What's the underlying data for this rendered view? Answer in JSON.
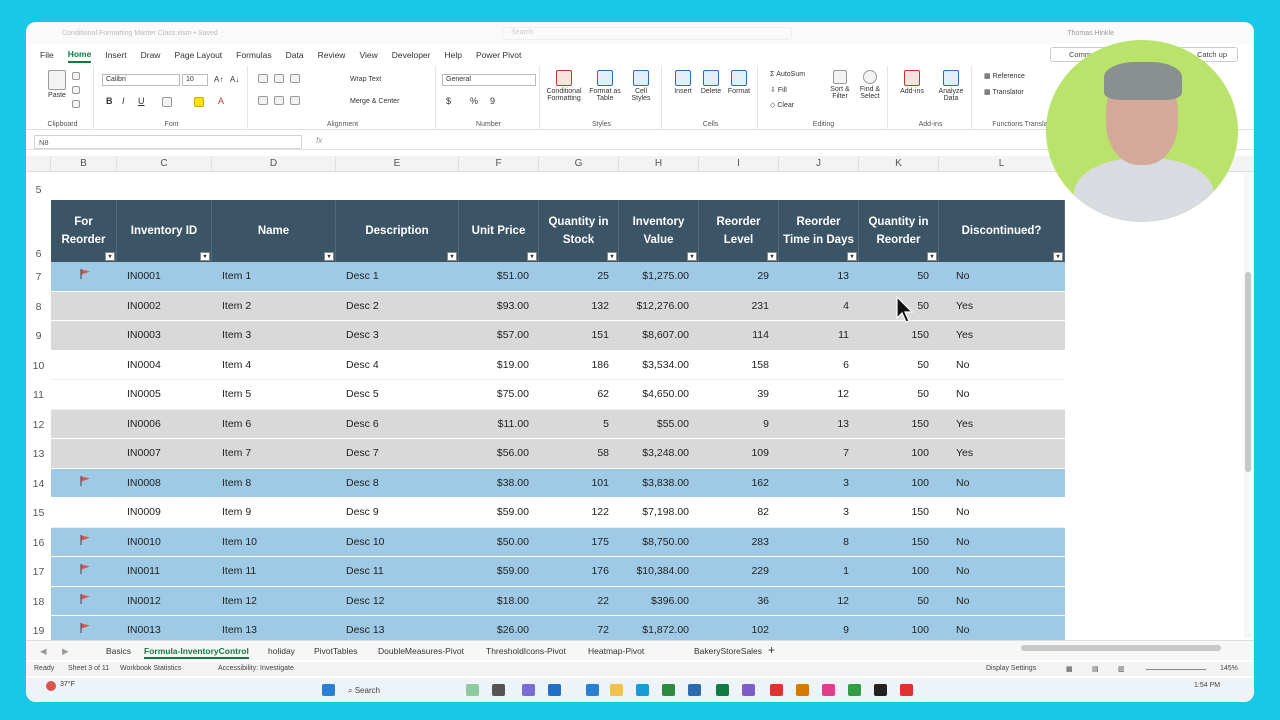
{
  "window": {
    "doc_title": "Conditional Formatting Master Class.xlsm • Saved",
    "search_placeholder": "Search",
    "user_name": "Thomas Hinkle",
    "comments_label": "Comm",
    "catch_up_label": "Catch up"
  },
  "menu_tabs": [
    "File",
    "Home",
    "Insert",
    "Draw",
    "Page Layout",
    "Formulas",
    "Data",
    "Review",
    "View",
    "Developer",
    "Help",
    "Power Pivot"
  ],
  "active_tab": "Home",
  "ribbon": {
    "clipboard": {
      "paste": "Paste",
      "label": "Clipboard"
    },
    "font": {
      "name": "Calibri",
      "size": "10",
      "label": "Font",
      "bold": "B",
      "italic": "I",
      "underline": "U"
    },
    "alignment": {
      "wrap": "Wrap Text",
      "merge": "Merge & Center",
      "label": "Alignment"
    },
    "number": {
      "format": "General",
      "currency": "$",
      "percent": "%",
      "comma": "9",
      "label": "Number"
    },
    "styles": {
      "conditional": "Conditional Formatting",
      "table": "Format as Table",
      "cell": "Cell Styles",
      "label": "Styles"
    },
    "cells": {
      "insert": "Insert",
      "delete": "Delete",
      "format": "Format",
      "label": "Cells"
    },
    "editing": {
      "autosum": "AutoSum",
      "fill": "Fill",
      "clear": "Clear",
      "sort": "Sort & Filter",
      "find": "Find & Select",
      "label": "Editing"
    },
    "addins": {
      "addins": "Add-ins",
      "analyze": "Analyze Data",
      "label": "Add-ins"
    },
    "functions": {
      "reference": "Reference",
      "translator": "Translator",
      "label": "Functions Translator"
    }
  },
  "formula_bar": {
    "name_box": "N8",
    "fx": "fx",
    "value": ""
  },
  "column_letters": [
    "B",
    "C",
    "D",
    "E",
    "F",
    "G",
    "H",
    "I",
    "J",
    "K",
    "L"
  ],
  "table": {
    "headers": [
      "For Reorder",
      "Inventory ID",
      "Name",
      "Description",
      "Unit Price",
      "Quantity in Stock",
      "Inventory Value",
      "Reorder Level",
      "Reorder Time in Days",
      "Quantity in Reorder",
      "Discontinued?"
    ],
    "rows": [
      {
        "row": "7",
        "flag": true,
        "style": "blue",
        "id": "IN0001",
        "name": "Item 1",
        "desc": "Desc 1",
        "price": "$51.00",
        "qty": "25",
        "value": "$1,275.00",
        "level": "29",
        "days": "13",
        "reorder": "50",
        "disc": "No"
      },
      {
        "row": "8",
        "flag": false,
        "style": "grey",
        "id": "IN0002",
        "name": "Item 2",
        "desc": "Desc 2",
        "price": "$93.00",
        "qty": "132",
        "value": "$12,276.00",
        "level": "231",
        "days": "4",
        "reorder": "50",
        "disc": "Yes"
      },
      {
        "row": "9",
        "flag": false,
        "style": "grey",
        "id": "IN0003",
        "name": "Item 3",
        "desc": "Desc 3",
        "price": "$57.00",
        "qty": "151",
        "value": "$8,607.00",
        "level": "114",
        "days": "11",
        "reorder": "150",
        "disc": "Yes"
      },
      {
        "row": "10",
        "flag": false,
        "style": "white",
        "id": "IN0004",
        "name": "Item 4",
        "desc": "Desc 4",
        "price": "$19.00",
        "qty": "186",
        "value": "$3,534.00",
        "level": "158",
        "days": "6",
        "reorder": "50",
        "disc": "No"
      },
      {
        "row": "11",
        "flag": false,
        "style": "white",
        "id": "IN0005",
        "name": "Item 5",
        "desc": "Desc 5",
        "price": "$75.00",
        "qty": "62",
        "value": "$4,650.00",
        "level": "39",
        "days": "12",
        "reorder": "50",
        "disc": "No"
      },
      {
        "row": "12",
        "flag": false,
        "style": "grey",
        "id": "IN0006",
        "name": "Item 6",
        "desc": "Desc 6",
        "price": "$11.00",
        "qty": "5",
        "value": "$55.00",
        "level": "9",
        "days": "13",
        "reorder": "150",
        "disc": "Yes"
      },
      {
        "row": "13",
        "flag": false,
        "style": "grey",
        "id": "IN0007",
        "name": "Item 7",
        "desc": "Desc 7",
        "price": "$56.00",
        "qty": "58",
        "value": "$3,248.00",
        "level": "109",
        "days": "7",
        "reorder": "100",
        "disc": "Yes"
      },
      {
        "row": "14",
        "flag": true,
        "style": "blue",
        "id": "IN0008",
        "name": "Item 8",
        "desc": "Desc 8",
        "price": "$38.00",
        "qty": "101",
        "value": "$3,838.00",
        "level": "162",
        "days": "3",
        "reorder": "100",
        "disc": "No"
      },
      {
        "row": "15",
        "flag": false,
        "style": "white",
        "id": "IN0009",
        "name": "Item 9",
        "desc": "Desc 9",
        "price": "$59.00",
        "qty": "122",
        "value": "$7,198.00",
        "level": "82",
        "days": "3",
        "reorder": "150",
        "disc": "No"
      },
      {
        "row": "16",
        "flag": true,
        "style": "blue",
        "id": "IN0010",
        "name": "Item 10",
        "desc": "Desc 10",
        "price": "$50.00",
        "qty": "175",
        "value": "$8,750.00",
        "level": "283",
        "days": "8",
        "reorder": "150",
        "disc": "No"
      },
      {
        "row": "17",
        "flag": true,
        "style": "blue",
        "id": "IN0011",
        "name": "Item 11",
        "desc": "Desc 11",
        "price": "$59.00",
        "qty": "176",
        "value": "$10,384.00",
        "level": "229",
        "days": "1",
        "reorder": "100",
        "disc": "No"
      },
      {
        "row": "18",
        "flag": true,
        "style": "blue",
        "id": "IN0012",
        "name": "Item 12",
        "desc": "Desc 12",
        "price": "$18.00",
        "qty": "22",
        "value": "$396.00",
        "level": "36",
        "days": "12",
        "reorder": "50",
        "disc": "No"
      },
      {
        "row": "19",
        "flag": true,
        "style": "blue",
        "id": "IN0013",
        "name": "Item 13",
        "desc": "Desc 13",
        "price": "$26.00",
        "qty": "72",
        "value": "$1,872.00",
        "level": "102",
        "days": "9",
        "reorder": "100",
        "disc": "No"
      }
    ]
  },
  "row_numbers_top": [
    "5",
    "6"
  ],
  "sheet_tabs": [
    "Basics",
    "Formula-InventoryControl",
    "holiday",
    "PivotTables",
    "DoubleMeasures-Pivot",
    "ThresholdIcons-Pivot",
    "Heatmap-Pivot",
    "BakeryStoreSales"
  ],
  "active_sheet": "Formula-InventoryControl",
  "status": {
    "ready": "Ready",
    "sheet": "Sheet 3 of 11",
    "stats": "Workbook Statistics",
    "access": "Accessibility: Investigate",
    "display": "Display Settings",
    "zoom": "145%"
  },
  "taskbar": {
    "weather": "37°F",
    "search": "Search",
    "time": "1:54 PM"
  },
  "colors": {
    "header_bg": "#3b5466",
    "blue_row": "#9fcae6",
    "grey_row": "#d9d9d9",
    "flag": "#d9534f",
    "accent": "#107c41"
  }
}
